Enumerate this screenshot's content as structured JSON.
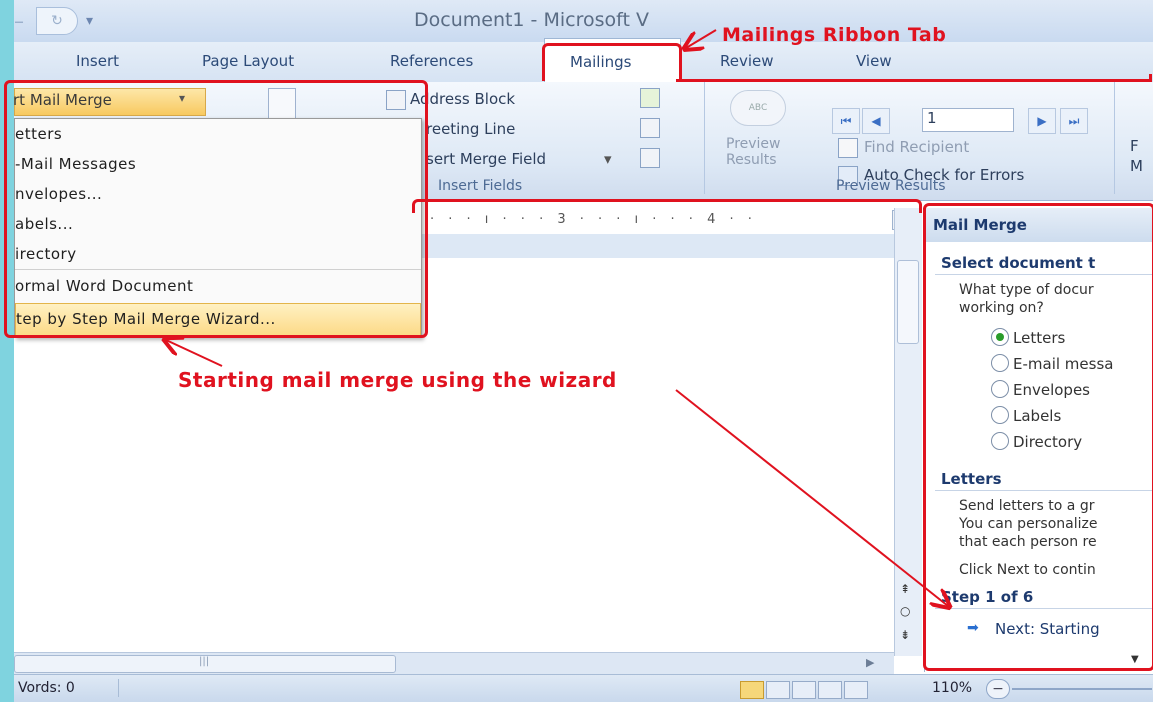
{
  "title_bar": {
    "document_title": "Document1 - Microsoft V",
    "qat_redo_icon": "redo-icon",
    "qat_customize_icon": "customize-arrow-icon"
  },
  "tabs": [
    {
      "label": "Insert"
    },
    {
      "label": "Page Layout"
    },
    {
      "label": "References"
    },
    {
      "label": "Mailings"
    },
    {
      "label": "Review"
    },
    {
      "label": "View"
    }
  ],
  "ribbon": {
    "start_mail_merge": "rt Mail Merge",
    "write_insert": {
      "address_block": "Address Block",
      "greeting_line": "reeting Line",
      "insert_merge_field": "sert Merge Field",
      "group_label": "Insert Fields"
    },
    "preview": {
      "preview_results_label": "Preview\nResults",
      "record_number": "1",
      "find_recipient": "Find Recipient",
      "auto_check": "Auto Check for Errors",
      "group_label": "Preview Results",
      "finish_partial": "F\nM"
    }
  },
  "dropdown": {
    "items": [
      {
        "label": "etters"
      },
      {
        "label": "-Mail Messages"
      },
      {
        "label": "nvelopes..."
      },
      {
        "label": "abels..."
      },
      {
        "label": "irectory"
      },
      {
        "label": "ormal Word Document"
      },
      {
        "label": "tep by Step Mail Merge Wizard..."
      }
    ]
  },
  "ruler": {
    "marks": "· · · ı · · · 3 · · · ı · · · 4 · ·"
  },
  "mail_merge_pane": {
    "title": "Mail Merge",
    "select_heading": "Select document t",
    "question_line1": "What type of docur",
    "question_line2": "working on?",
    "options": [
      {
        "label": "Letters",
        "selected": true
      },
      {
        "label": "E-mail messa",
        "selected": false
      },
      {
        "label": "Envelopes",
        "selected": false
      },
      {
        "label": "Labels",
        "selected": false
      },
      {
        "label": "Directory",
        "selected": false
      }
    ],
    "letters_heading": "Letters",
    "letters_desc": [
      "Send letters to a gr",
      "You can personalize",
      "that each person re"
    ],
    "click_next": "Click Next to contin",
    "step_label": "Step 1 of 6",
    "next_link": "Next: Starting"
  },
  "status_bar": {
    "words": "Vords: 0",
    "zoom": "110%"
  },
  "annotations": {
    "ribbon_tab": "Mailings Ribbon Tab",
    "wizard": "Starting mail merge using the wizard",
    "color": "#e0121f"
  }
}
